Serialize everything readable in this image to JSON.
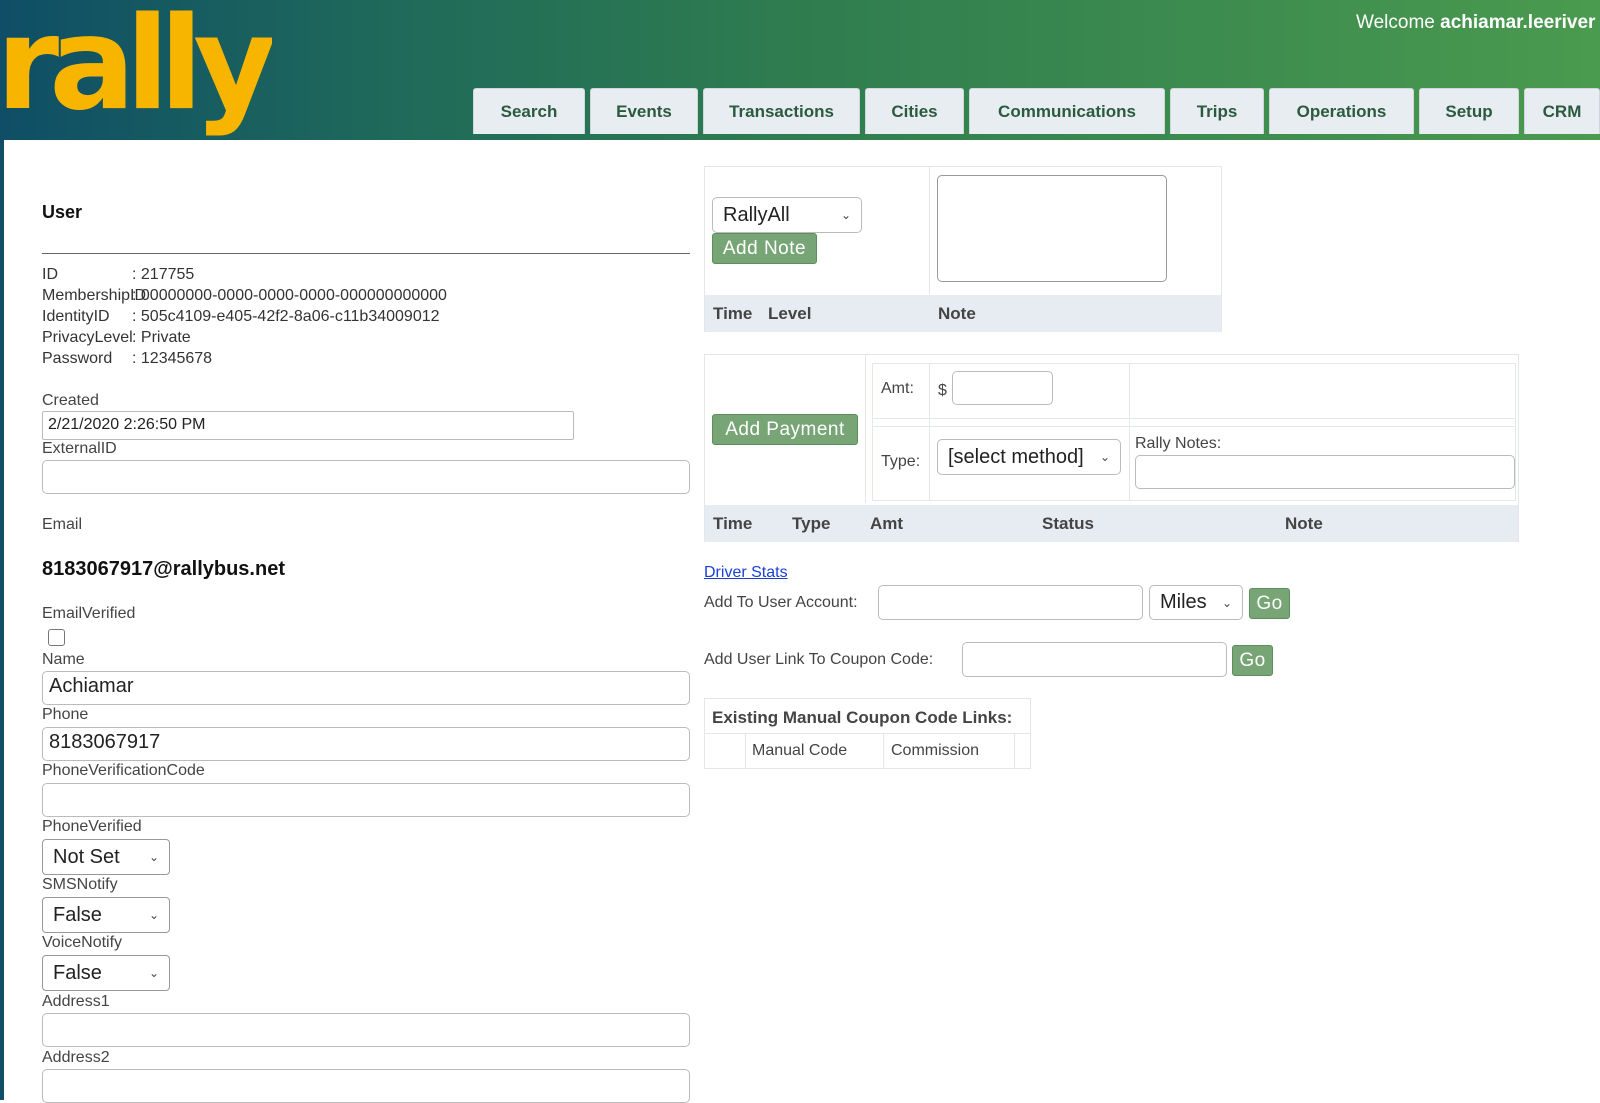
{
  "header": {
    "logo_text": "rally",
    "welcome_prefix": "Welcome",
    "welcome_user": "achiamar.leeriver",
    "tabs": [
      {
        "label": "Search"
      },
      {
        "label": "Events"
      },
      {
        "label": "Transactions"
      },
      {
        "label": "Cities"
      },
      {
        "label": "Communications"
      },
      {
        "label": "Trips"
      },
      {
        "label": "Operations"
      },
      {
        "label": "Setup"
      },
      {
        "label": "CRM"
      }
    ]
  },
  "user": {
    "section_title": "User",
    "fields": [
      {
        "key": "ID",
        "value": ": 217755"
      },
      {
        "key": "MembershipID",
        "value": ": 00000000-0000-0000-0000-000000000000"
      },
      {
        "key": "IdentityID",
        "value": ": 505c4109-e405-42f2-8a06-c11b34009012"
      },
      {
        "key": "PrivacyLevel",
        "value": ": Private"
      },
      {
        "key": "Password",
        "value": ": 12345678"
      }
    ],
    "created_label": "Created",
    "created_value": "2/21/2020 2:26:50 PM",
    "externalid_label": "ExternalID",
    "externalid_value": "",
    "email_label": "Email",
    "email_value": "8183067917@rallybus.net",
    "emailverified_label": "EmailVerified",
    "name_label": "Name",
    "name_value": "Achiamar",
    "phone_label": "Phone",
    "phone_value": "8183067917",
    "phonecode_label": "PhoneVerificationCode",
    "phonecode_value": "",
    "phoneverified_label": "PhoneVerified",
    "phoneverified_value": "Not Set",
    "smsnotify_label": "SMSNotify",
    "smsnotify_value": "False",
    "voicenotify_label": "VoiceNotify",
    "voicenotify_value": "False",
    "address1_label": "Address1",
    "address1_value": "",
    "address2_label": "Address2",
    "address2_value": ""
  },
  "notes": {
    "level_select": "RallyAll",
    "add_note_label": "Add Note",
    "columns": [
      "Time",
      "Level",
      "Note"
    ]
  },
  "payments": {
    "add_payment_label": "Add Payment",
    "amt_label": "Amt:",
    "currency": "$",
    "amt_value": "",
    "type_label": "Type:",
    "type_select": "[select method]",
    "rally_notes_label": "Rally Notes:",
    "columns": [
      "Time",
      "Type",
      "Amt",
      "Status",
      "Note"
    ]
  },
  "tools": {
    "driver_stats_label": "Driver Stats",
    "add_to_account_label": "Add To User Account:",
    "unit_select": "Miles",
    "go_label": "Go",
    "coupon_link_label": "Add User Link To Coupon Code:",
    "coupon_go_label": "Go"
  },
  "coupons": {
    "title": "Existing Manual Coupon Code Links:",
    "columns": [
      "Manual Code",
      "Commission"
    ]
  },
  "colors": {
    "accent_green": "#77a576",
    "logo_yellow": "#f7b500",
    "header_start": "#0f4e66",
    "header_end": "#4a9a4f"
  }
}
